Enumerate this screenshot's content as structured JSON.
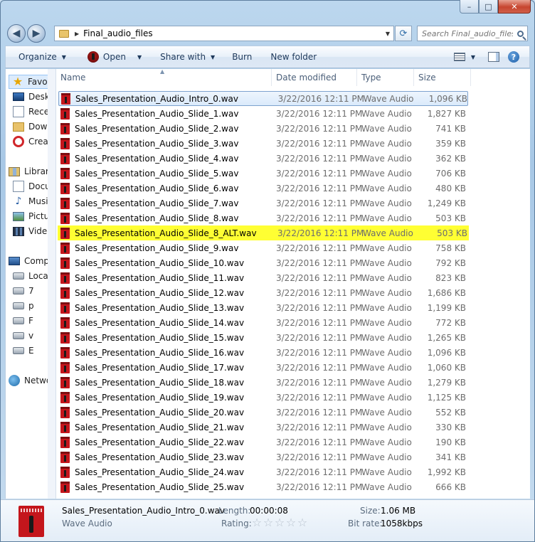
{
  "window": {
    "controls": {
      "minimize": "–",
      "maximize": "□",
      "close": "✕"
    }
  },
  "address": {
    "path": "Final_audio_files",
    "search_placeholder": "Search Final_audio_files"
  },
  "toolbar": {
    "organize": "Organize",
    "open": "Open",
    "share_with": "Share with",
    "burn": "Burn",
    "new_folder": "New folder"
  },
  "nav": {
    "favorites": "Favorites",
    "fav_items": [
      "Desktop",
      "Recent Places",
      "Downloads",
      "Creative Cloud Files"
    ],
    "libraries": "Libraries",
    "lib_items": [
      "Documents",
      "Music",
      "Pictures",
      "Videos"
    ],
    "computer": "Computer",
    "comp_items": [
      "Local Disk",
      "7",
      "p",
      "F",
      "v",
      "E"
    ],
    "network": "Network"
  },
  "columns": {
    "name": "Name",
    "date": "Date modified",
    "type": "Type",
    "size": "Size"
  },
  "files": [
    {
      "name": "Sales_Presentation_Audio_Intro_0.wav",
      "date": "3/22/2016 12:11 PM",
      "type": "Wave Audio",
      "size": "1,096 KB",
      "state": "selected"
    },
    {
      "name": "Sales_Presentation_Audio_Slide_1.wav",
      "date": "3/22/2016 12:11 PM",
      "type": "Wave Audio",
      "size": "1,827 KB"
    },
    {
      "name": "Sales_Presentation_Audio_Slide_2.wav",
      "date": "3/22/2016 12:11 PM",
      "type": "Wave Audio",
      "size": "741 KB"
    },
    {
      "name": "Sales_Presentation_Audio_Slide_3.wav",
      "date": "3/22/2016 12:11 PM",
      "type": "Wave Audio",
      "size": "359 KB"
    },
    {
      "name": "Sales_Presentation_Audio_Slide_4.wav",
      "date": "3/22/2016 12:11 PM",
      "type": "Wave Audio",
      "size": "362 KB"
    },
    {
      "name": "Sales_Presentation_Audio_Slide_5.wav",
      "date": "3/22/2016 12:11 PM",
      "type": "Wave Audio",
      "size": "706 KB"
    },
    {
      "name": "Sales_Presentation_Audio_Slide_6.wav",
      "date": "3/22/2016 12:11 PM",
      "type": "Wave Audio",
      "size": "480 KB"
    },
    {
      "name": "Sales_Presentation_Audio_Slide_7.wav",
      "date": "3/22/2016 12:11 PM",
      "type": "Wave Audio",
      "size": "1,249 KB"
    },
    {
      "name": "Sales_Presentation_Audio_Slide_8.wav",
      "date": "3/22/2016 12:11 PM",
      "type": "Wave Audio",
      "size": "503 KB"
    },
    {
      "name": "Sales_Presentation_Audio_Slide_8_ALT.wav",
      "date": "3/22/2016 12:11 PM",
      "type": "Wave Audio",
      "size": "503 KB",
      "state": "highlighted"
    },
    {
      "name": "Sales_Presentation_Audio_Slide_9.wav",
      "date": "3/22/2016 12:11 PM",
      "type": "Wave Audio",
      "size": "758 KB"
    },
    {
      "name": "Sales_Presentation_Audio_Slide_10.wav",
      "date": "3/22/2016 12:11 PM",
      "type": "Wave Audio",
      "size": "792 KB"
    },
    {
      "name": "Sales_Presentation_Audio_Slide_11.wav",
      "date": "3/22/2016 12:11 PM",
      "type": "Wave Audio",
      "size": "823 KB"
    },
    {
      "name": "Sales_Presentation_Audio_Slide_12.wav",
      "date": "3/22/2016 12:11 PM",
      "type": "Wave Audio",
      "size": "1,686 KB"
    },
    {
      "name": "Sales_Presentation_Audio_Slide_13.wav",
      "date": "3/22/2016 12:11 PM",
      "type": "Wave Audio",
      "size": "1,199 KB"
    },
    {
      "name": "Sales_Presentation_Audio_Slide_14.wav",
      "date": "3/22/2016 12:11 PM",
      "type": "Wave Audio",
      "size": "772 KB"
    },
    {
      "name": "Sales_Presentation_Audio_Slide_15.wav",
      "date": "3/22/2016 12:11 PM",
      "type": "Wave Audio",
      "size": "1,265 KB"
    },
    {
      "name": "Sales_Presentation_Audio_Slide_16.wav",
      "date": "3/22/2016 12:11 PM",
      "type": "Wave Audio",
      "size": "1,096 KB"
    },
    {
      "name": "Sales_Presentation_Audio_Slide_17.wav",
      "date": "3/22/2016 12:11 PM",
      "type": "Wave Audio",
      "size": "1,060 KB"
    },
    {
      "name": "Sales_Presentation_Audio_Slide_18.wav",
      "date": "3/22/2016 12:11 PM",
      "type": "Wave Audio",
      "size": "1,279 KB"
    },
    {
      "name": "Sales_Presentation_Audio_Slide_19.wav",
      "date": "3/22/2016 12:11 PM",
      "type": "Wave Audio",
      "size": "1,125 KB"
    },
    {
      "name": "Sales_Presentation_Audio_Slide_20.wav",
      "date": "3/22/2016 12:11 PM",
      "type": "Wave Audio",
      "size": "552 KB"
    },
    {
      "name": "Sales_Presentation_Audio_Slide_21.wav",
      "date": "3/22/2016 12:11 PM",
      "type": "Wave Audio",
      "size": "330 KB"
    },
    {
      "name": "Sales_Presentation_Audio_Slide_22.wav",
      "date": "3/22/2016 12:11 PM",
      "type": "Wave Audio",
      "size": "190 KB"
    },
    {
      "name": "Sales_Presentation_Audio_Slide_23.wav",
      "date": "3/22/2016 12:11 PM",
      "type": "Wave Audio",
      "size": "341 KB"
    },
    {
      "name": "Sales_Presentation_Audio_Slide_24.wav",
      "date": "3/22/2016 12:11 PM",
      "type": "Wave Audio",
      "size": "1,992 KB"
    },
    {
      "name": "Sales_Presentation_Audio_Slide_25.wav",
      "date": "3/22/2016 12:11 PM",
      "type": "Wave Audio",
      "size": "666 KB"
    }
  ],
  "details": {
    "name": "Sales_Presentation_Audio_Intro_0.wav",
    "type": "Wave Audio",
    "length_label": "Length:",
    "length": "00:00:08",
    "rating_label": "Rating:",
    "size_label": "Size:",
    "size": "1.06 MB",
    "bitrate_label": "Bit rate:",
    "bitrate": "1058kbps"
  },
  "colors": {
    "highlight": "#ffff33",
    "selection": "#dbeafb",
    "file_icon": "#c4161c"
  }
}
